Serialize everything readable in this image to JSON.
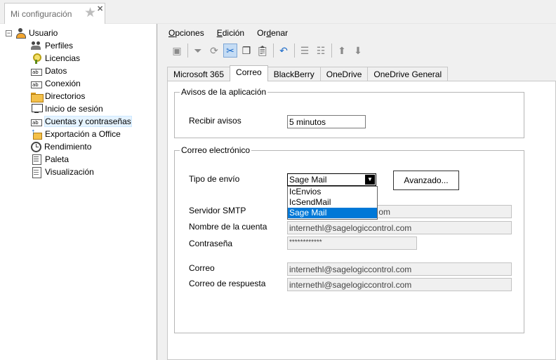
{
  "window": {
    "tab_title": "Mi configuración"
  },
  "tree": {
    "root": {
      "label": "Usuario",
      "icon": "user-icon"
    },
    "items": [
      {
        "label": "Perfiles",
        "icon": "users-icon"
      },
      {
        "label": "Licencias",
        "icon": "key-icon"
      },
      {
        "label": "Datos",
        "icon": "text-field-icon"
      },
      {
        "label": "Conexión",
        "icon": "text-field-icon"
      },
      {
        "label": "Directorios",
        "icon": "folder-icon"
      },
      {
        "label": "Inicio de sesión",
        "icon": "monitor-icon"
      },
      {
        "label": "Cuentas y contraseñas",
        "icon": "text-field-icon",
        "selected": true
      },
      {
        "label": "Exportación a Office",
        "icon": "export-icon"
      },
      {
        "label": "Rendimiento",
        "icon": "clock-icon"
      },
      {
        "label": "Paleta",
        "icon": "palette-icon"
      },
      {
        "label": "Visualización",
        "icon": "document-icon"
      }
    ]
  },
  "menu": {
    "opciones": {
      "hot": "O",
      "rest": "pciones"
    },
    "edicion": {
      "hot": "E",
      "rest": "dición"
    },
    "ordenar_pre": "Or",
    "ordenar_hot": "d",
    "ordenar_post": "enar"
  },
  "tabs": [
    "Microsoft 365",
    "Correo",
    "BlackBerry",
    "OneDrive",
    "OneDrive General"
  ],
  "active_tab": "Correo",
  "avisos": {
    "legend": "Avisos de la aplicación",
    "recibir_label": "Recibir avisos",
    "recibir_value": "5 minutos"
  },
  "correo": {
    "legend": "Correo electrónico",
    "tipo_label": "Tipo de envío",
    "tipo_value": "Sage Mail",
    "tipo_options": [
      "IcEnvios",
      "IcSendMail",
      "Sage Mail"
    ],
    "avanzado_label": "Avanzado...",
    "smtp_label": "Servidor SMTP",
    "smtp_value_visible": "om",
    "cuenta_label": "Nombre de la cuenta",
    "cuenta_value": "internethl@sagelogiccontrol.com",
    "pass_label": "Contraseña",
    "pass_value": "************",
    "correo_label": "Correo",
    "correo_value": "internethl@sagelogiccontrol.com",
    "respuesta_label": "Correo de respuesta",
    "respuesta_value": "internethl@sagelogiccontrol.com"
  },
  "colors": {
    "selection": "#0078d7",
    "tree_selected": "#e5f3ff",
    "accent_toolbar": "#1b6ac9"
  }
}
